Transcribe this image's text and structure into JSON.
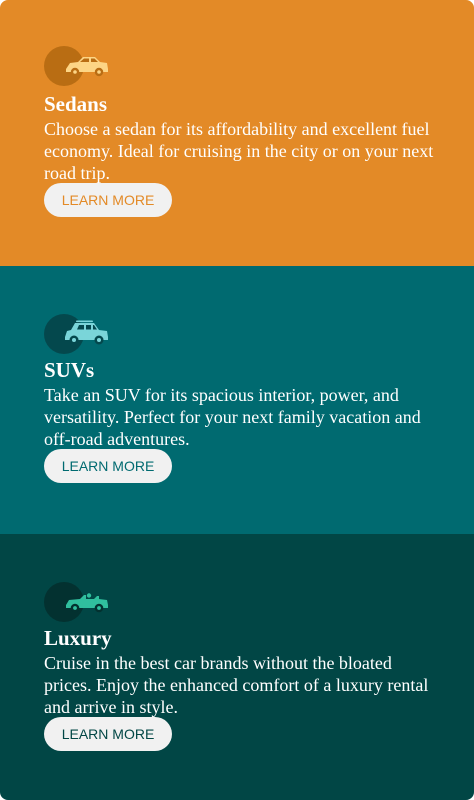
{
  "cards": [
    {
      "title": "Sedans",
      "description": "Choose a sedan for its affordability and excellent fuel economy. Ideal for cruising in the city or on your next road trip.",
      "button_label": "LEARN MORE",
      "icon": "sedan-car-icon",
      "background": "#e38a27",
      "disc_color": "#b96d13",
      "icon_color": "#fdd585",
      "button_text_color": "#e38a27"
    },
    {
      "title": "SUVs",
      "description": "Take an SUV for its spacious interior, power, and versatility. Perfect for your next family vacation and off-road adventures.",
      "button_label": "LEARN MORE",
      "icon": "suv-icon",
      "background": "#006a70",
      "disc_color": "#04484d",
      "icon_color": "#7ad5d9",
      "button_text_color": "#006a70"
    },
    {
      "title": "Luxury",
      "description": "Cruise in the best car brands without the bloated prices. Enjoy the enhanced comfort of a luxury rental and arrive in style.",
      "button_label": "LEARN MORE",
      "icon": "convertible-car-icon",
      "background": "#014645",
      "disc_color": "#033130",
      "icon_color": "#30bf9e",
      "button_text_color": "#014645"
    }
  ]
}
